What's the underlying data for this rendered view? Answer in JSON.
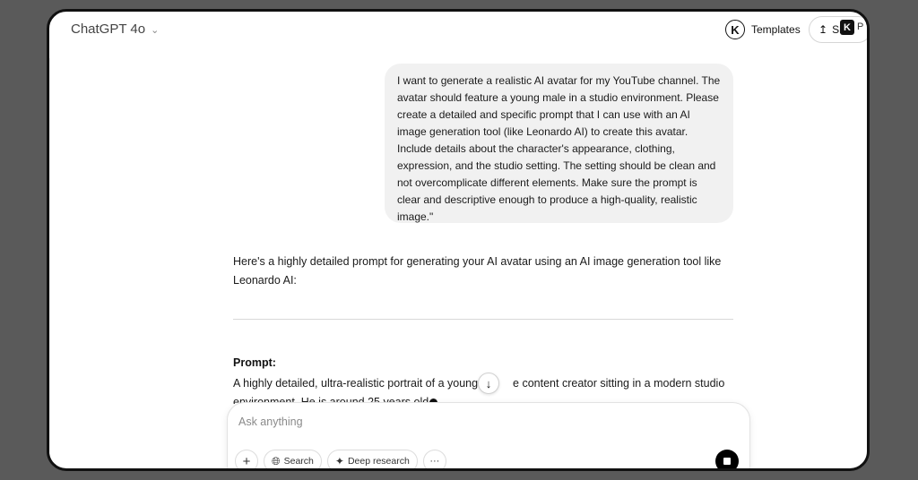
{
  "header": {
    "model_name": "ChatGPT 4o",
    "templates_label": "Templates",
    "share_label": "Sh",
    "avatar_letter": "K",
    "badge_letter": "K",
    "badge_trailing": "P"
  },
  "conversation": {
    "user_message": "I want to generate a realistic AI avatar for my YouTube channel. The avatar should feature a young male in a studio environment. Please create a detailed and specific prompt that I can use with an AI image generation tool (like Leonardo AI) to create this avatar. Include details about the character's appearance, clothing, expression, and the studio setting. The setting should be clean and not overcomplicate different elements. Make sure the prompt is clear and descriptive enough to produce a high-quality, realistic image.\"",
    "assistant_intro": "Here's a highly detailed prompt for generating your AI avatar using an AI image generation tool like Leonardo AI:",
    "prompt_heading": "Prompt:",
    "prompt_line1_a": "A highly detailed, ultra-realistic portrait of a young",
    "prompt_line1_b": "e content creator sitting in a modern studio",
    "prompt_line2": "environment. He is around 25 years old"
  },
  "composer": {
    "placeholder": "Ask anything",
    "search_label": "Search",
    "deep_research_label": "Deep research",
    "more_label": "···"
  },
  "icons": {
    "model_chevron": "chevron-down-icon",
    "share": "upload-icon",
    "add": "plus-icon",
    "search": "globe-icon",
    "deep_research": "telescope-icon",
    "more": "ellipsis-icon",
    "stop": "stop-icon",
    "scroll_down": "arrow-down-icon"
  }
}
